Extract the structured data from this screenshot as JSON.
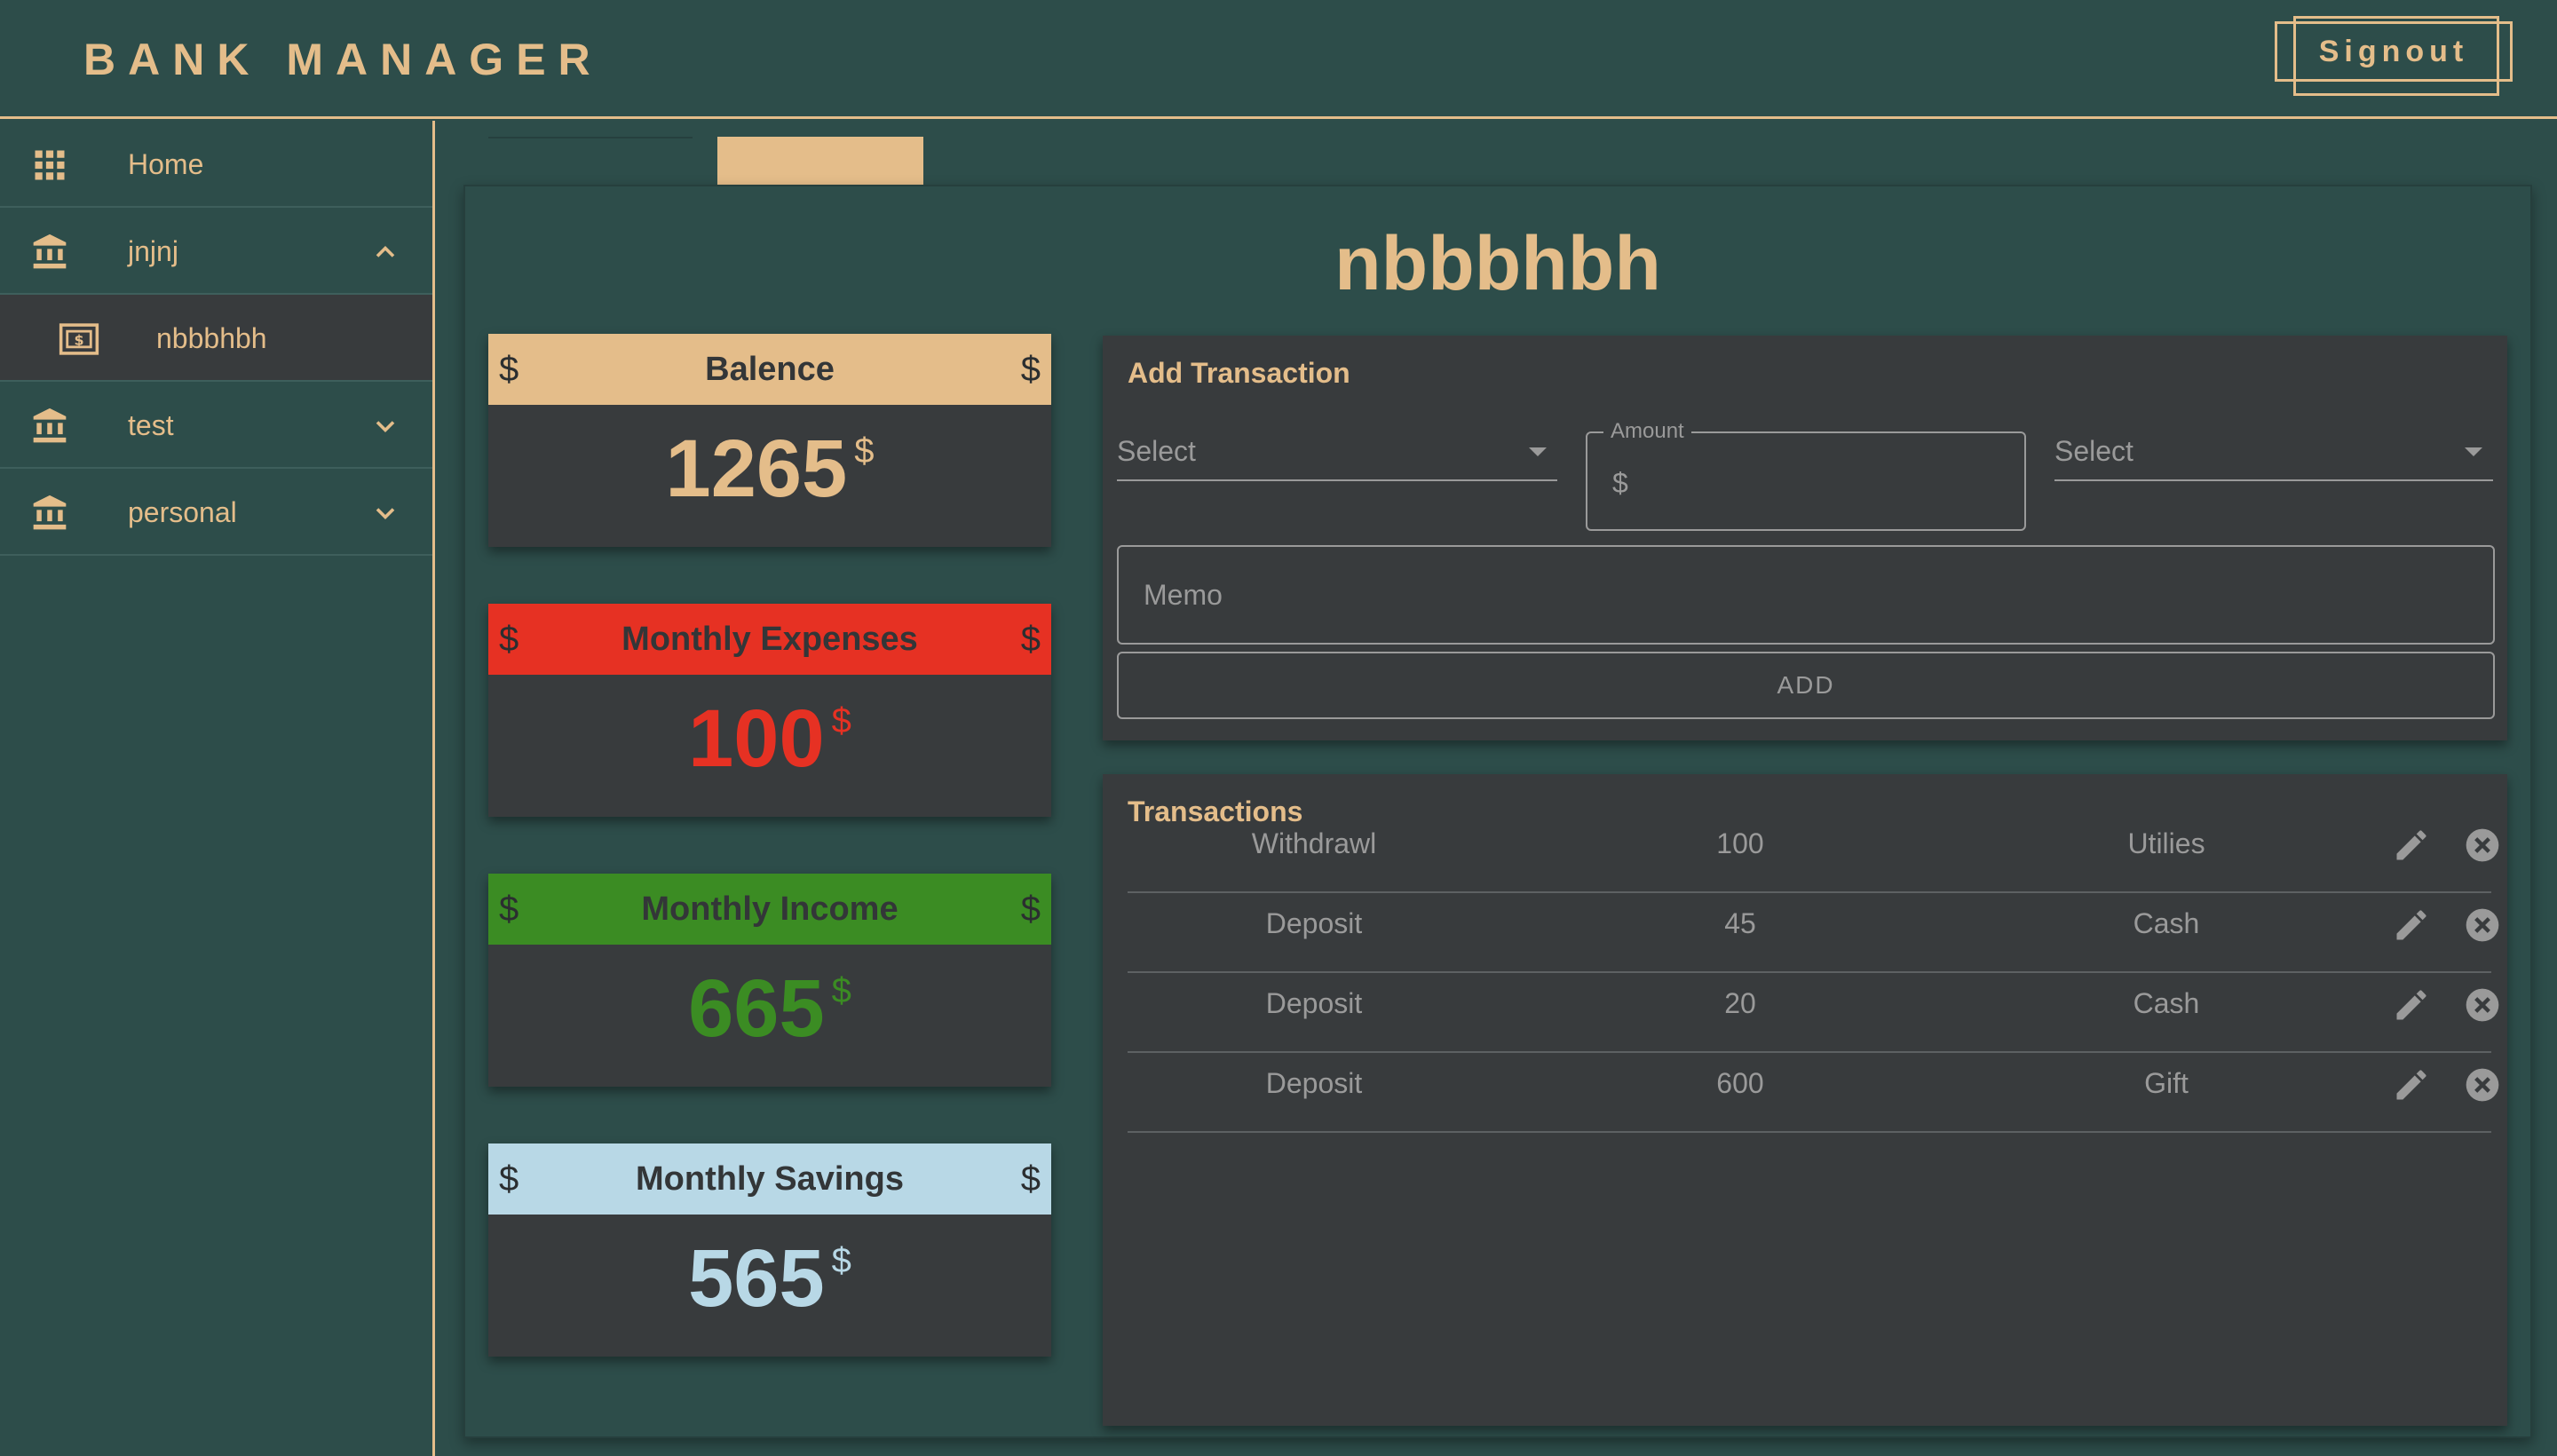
{
  "app": {
    "title": "BANK  MANAGER",
    "signout_label": "Signout"
  },
  "colors": {
    "teal": "#2d4d4a",
    "dark": "#383b3d",
    "tan": "#e4bd8a",
    "red": "#e63123",
    "green": "#3b8c23",
    "light_blue": "#b8d8e6"
  },
  "sidebar": {
    "items": [
      {
        "label": "Home",
        "icon": "grid-icon"
      },
      {
        "label": "jnjnj",
        "icon": "bank-icon",
        "expanded": true
      },
      {
        "label": "nbbbhbh",
        "icon": "cash-icon",
        "selected": true
      },
      {
        "label": "test",
        "icon": "bank-icon",
        "expanded": false
      },
      {
        "label": "personal",
        "icon": "bank-icon",
        "expanded": false
      }
    ]
  },
  "main": {
    "title": "nbbbhbh",
    "cards": [
      {
        "label": "Balence",
        "value": "1265",
        "currency": "$"
      },
      {
        "label": "Monthly Expenses",
        "value": "100",
        "currency": "$"
      },
      {
        "label": "Monthly Income",
        "value": "665",
        "currency": "$"
      },
      {
        "label": "Monthly Savings",
        "value": "565",
        "currency": "$"
      }
    ],
    "add_transaction": {
      "title": "Add Transaction",
      "type_select": "Select",
      "amount_label": "Amount",
      "amount_prefix": "$",
      "category_select": "Select",
      "memo_placeholder": "Memo",
      "add_label": "ADD"
    },
    "transactions": {
      "title": "Transactions",
      "rows": [
        {
          "type": "Withdrawl",
          "amount": "100",
          "category": "Utilies"
        },
        {
          "type": "Deposit",
          "amount": "45",
          "category": "Cash"
        },
        {
          "type": "Deposit",
          "amount": "20",
          "category": "Cash"
        },
        {
          "type": "Deposit",
          "amount": "600",
          "category": "Gift"
        }
      ]
    }
  }
}
